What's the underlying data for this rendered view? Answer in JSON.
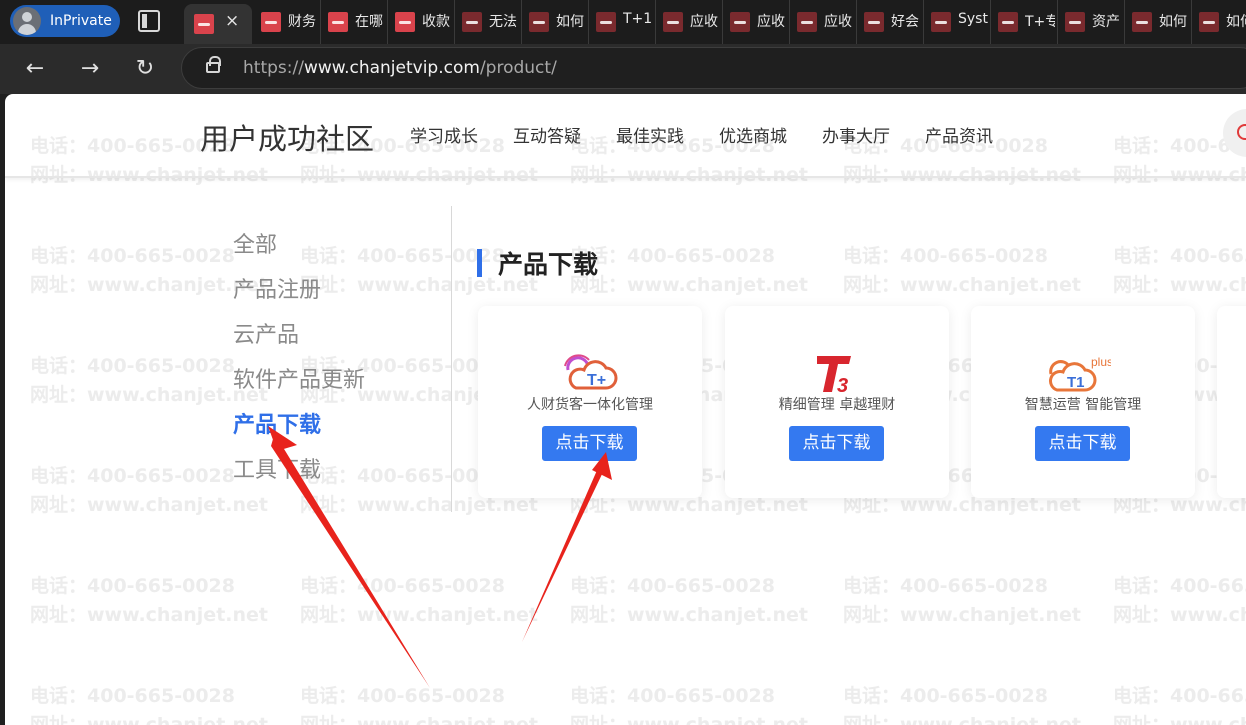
{
  "browser": {
    "profile_label": "InPrivate",
    "active_tab_close": "×",
    "tabs": [
      "财务",
      "在哪",
      "收款",
      "无法",
      "如何",
      "T+1",
      "应收",
      "应收",
      "应收",
      "好会",
      "Syst",
      "T+专",
      "资产",
      "如何",
      "如何"
    ],
    "url_scheme": "https://",
    "url_host": "www.chanjetvip.com",
    "url_path": "/product/"
  },
  "site": {
    "brand": "用户成功社区",
    "menu": [
      "学习成长",
      "互动答疑",
      "最佳实践",
      "优选商城",
      "办事大厅",
      "产品资讯"
    ]
  },
  "sidebar": {
    "items": [
      "全部",
      "产品注册",
      "云产品",
      "软件产品更新",
      "产品下载",
      "工具下载"
    ],
    "active_index": 4
  },
  "section": {
    "title": "产品下载"
  },
  "cards": [
    {
      "desc": "人财货客一体化管理",
      "button": "点击下载",
      "logo": "t-plus-cloud-logo"
    },
    {
      "desc": "精细管理 卓越理财",
      "button": "点击下载",
      "logo": "t3-logo"
    },
    {
      "desc": "智慧运营 智能管理",
      "button": "点击下载",
      "logo": "t1-plus-logo",
      "badge": "plus"
    }
  ],
  "watermark": {
    "phone": "电话：400-665-0028",
    "site": "网址：www.chanjet.net"
  },
  "colors": {
    "accent": "#2f6fe8",
    "button": "#3479f0",
    "annotation_arrow": "#e8231c"
  }
}
